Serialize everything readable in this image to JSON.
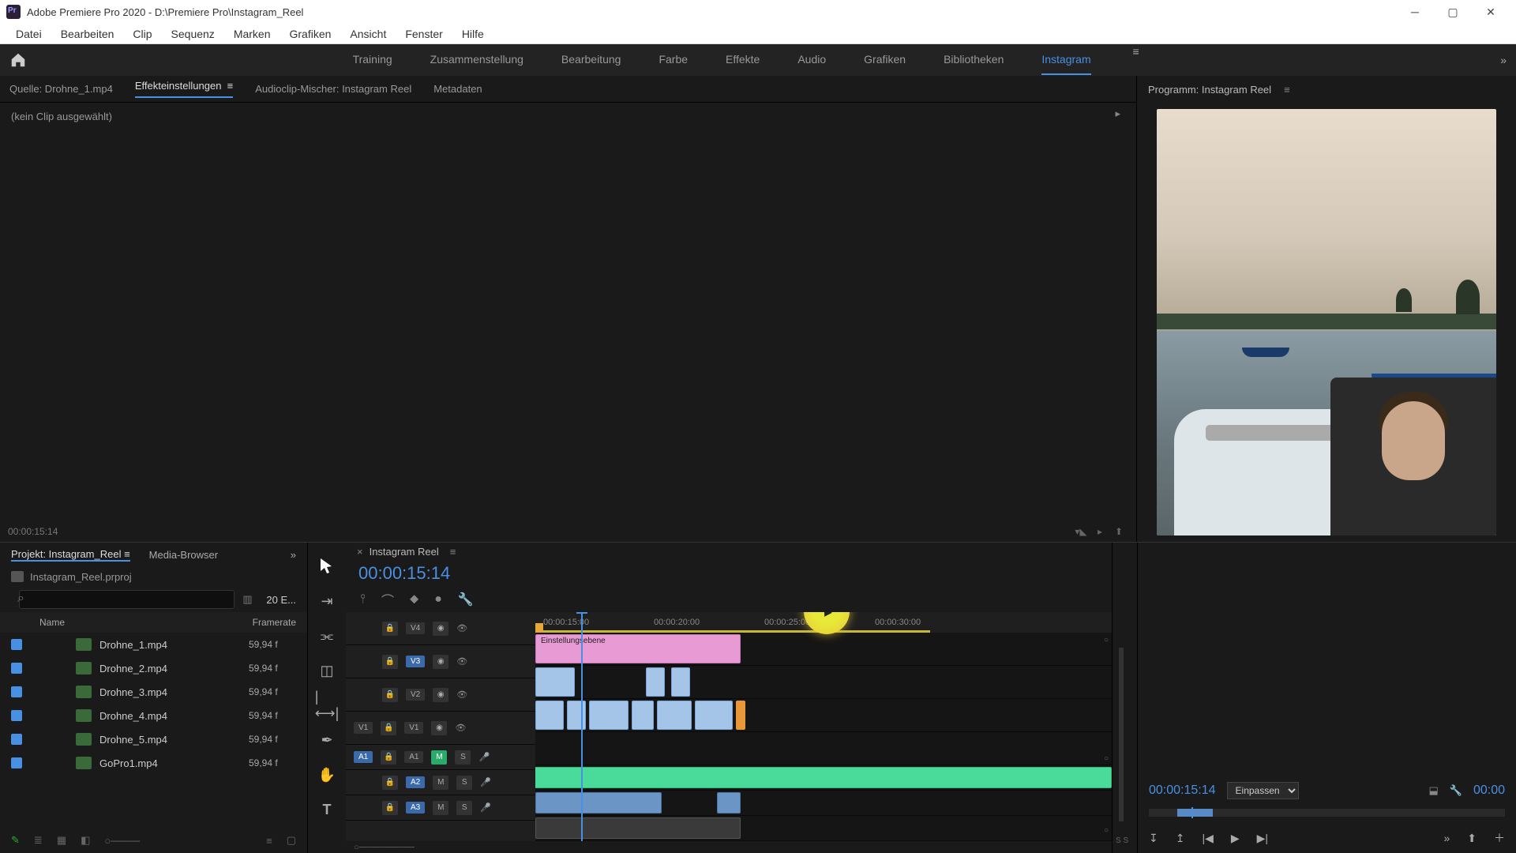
{
  "title": "Adobe Premiere Pro 2020 - D:\\Premiere Pro\\Instagram_Reel",
  "menu": [
    "Datei",
    "Bearbeiten",
    "Clip",
    "Sequenz",
    "Marken",
    "Grafiken",
    "Ansicht",
    "Fenster",
    "Hilfe"
  ],
  "workspaces": [
    "Training",
    "Zusammenstellung",
    "Bearbeitung",
    "Farbe",
    "Effekte",
    "Audio",
    "Grafiken",
    "Bibliotheken",
    "Instagram"
  ],
  "workspace_active": "Instagram",
  "source_tabs": {
    "source": "Quelle: Drohne_1.mp4",
    "effect": "Effekteinstellungen",
    "mixer": "Audioclip-Mischer: Instagram Reel",
    "meta": "Metadaten"
  },
  "source_body": "(kein Clip ausgewählt)",
  "source_tc": "00:00:15:14",
  "program_head": "Programm: Instagram Reel",
  "project": {
    "tabs": [
      "Projekt: Instagram_Reel",
      "Media-Browser"
    ],
    "file": "Instagram_Reel.prproj",
    "count": "20 E...",
    "cols": {
      "name": "Name",
      "fr": "Framerate"
    },
    "items": [
      {
        "name": "Drohne_1.mp4",
        "fr": "59,94 f"
      },
      {
        "name": "Drohne_2.mp4",
        "fr": "59,94 f"
      },
      {
        "name": "Drohne_3.mp4",
        "fr": "59,94 f"
      },
      {
        "name": "Drohne_4.mp4",
        "fr": "59,94 f"
      },
      {
        "name": "Drohne_5.mp4",
        "fr": "59,94 f"
      },
      {
        "name": "GoPro1.mp4",
        "fr": "59,94 f"
      }
    ]
  },
  "timeline": {
    "seq": "Instagram Reel",
    "tc": "00:00:15:14",
    "ticks": [
      "00:00:15:00",
      "00:00:20:00",
      "00:00:25:00",
      "00:00:30:00"
    ],
    "tracks": {
      "v4": "V4",
      "v3": "V3",
      "v2": "V2",
      "v1": "V1",
      "a1": "A1",
      "a2": "A2",
      "a3": "A3"
    },
    "src": {
      "v1": "V1",
      "a1": "A1"
    },
    "adj_clip": "Einstellungsebene"
  },
  "audiometer_label": "S S",
  "program_ctrl": {
    "tc": "00:00:15:14",
    "fit": "Einpassen",
    "tc2": "00:00"
  }
}
